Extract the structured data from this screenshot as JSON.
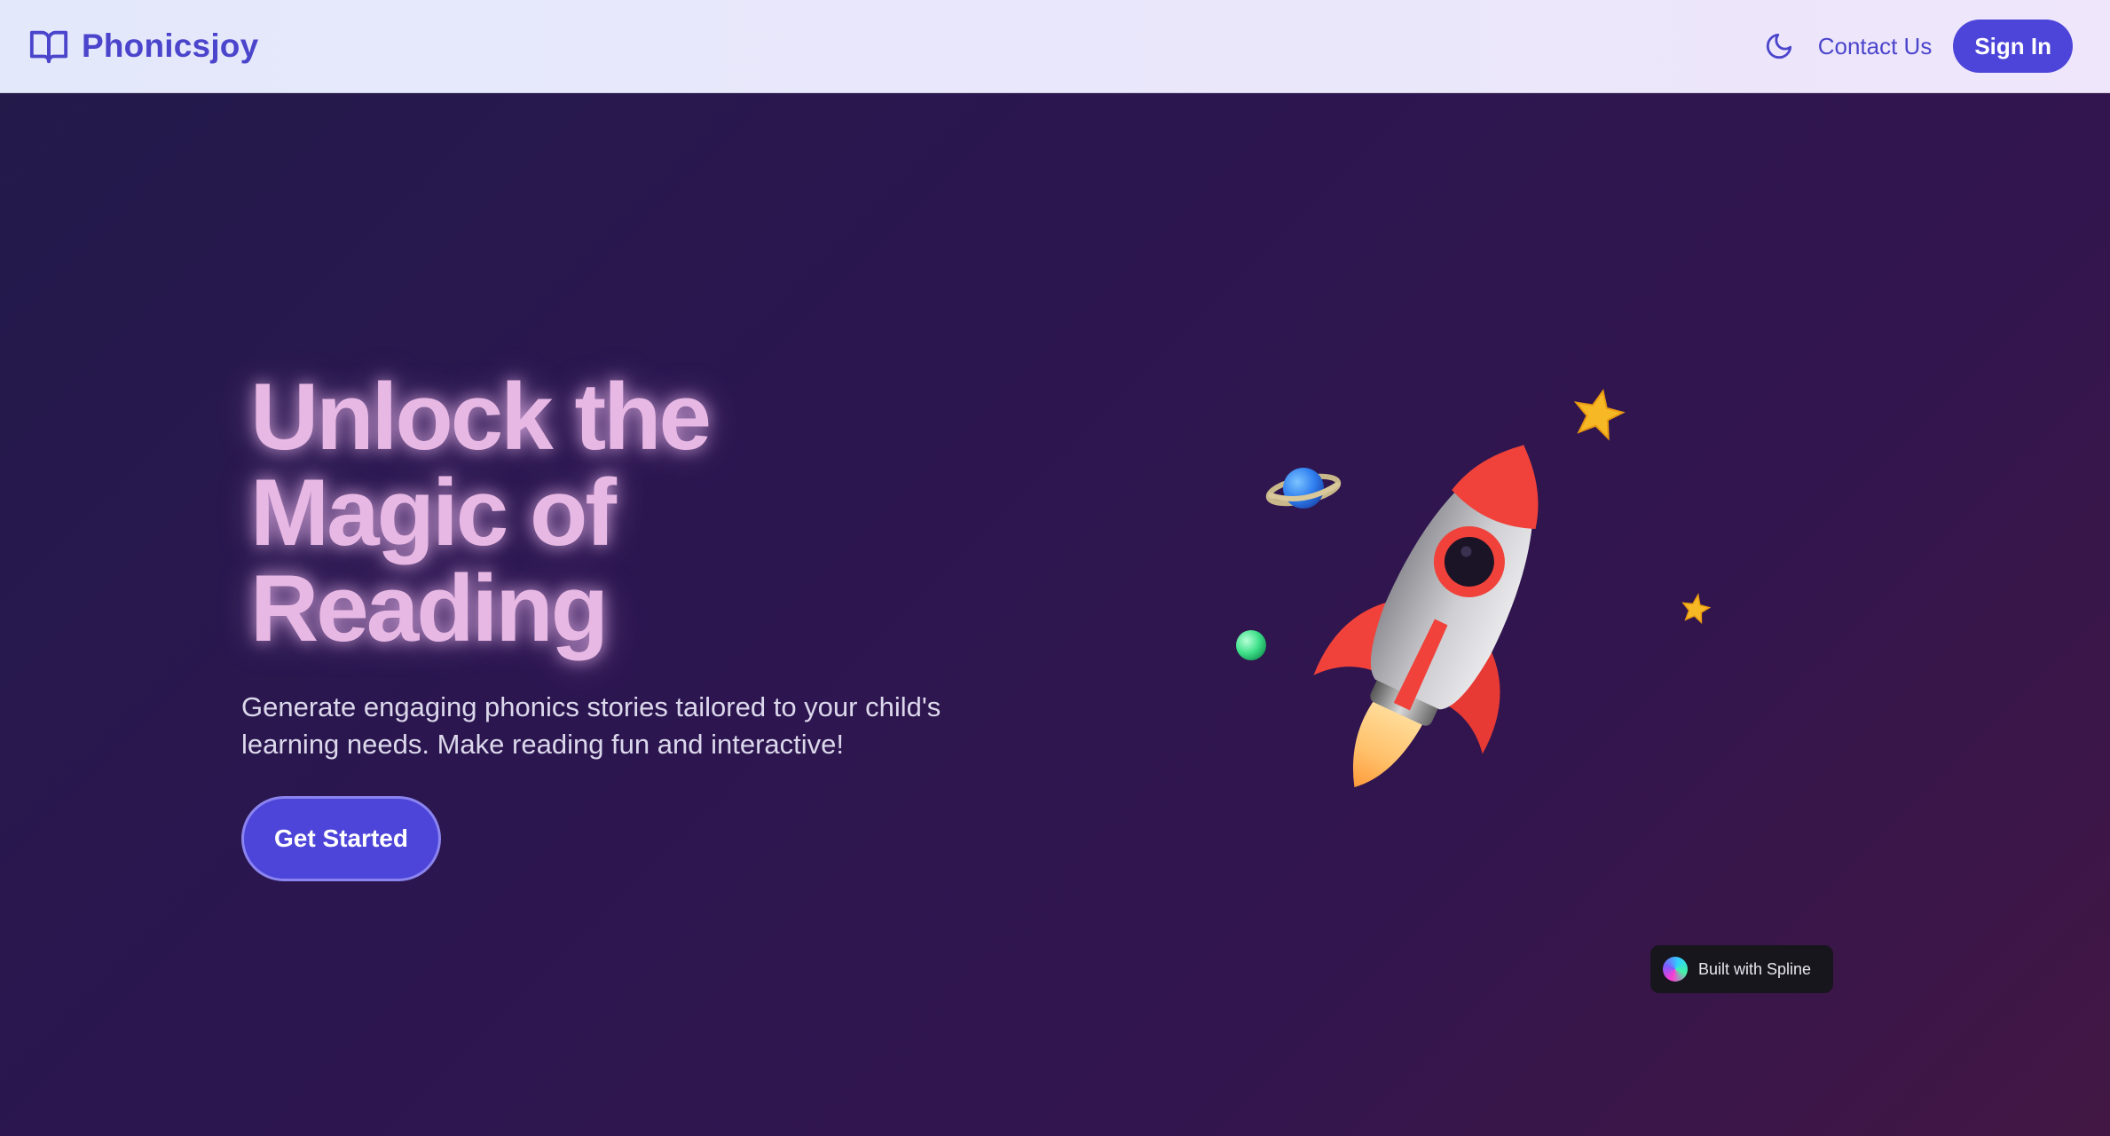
{
  "header": {
    "brand_name": "Phonicsjoy",
    "brand_icon": "open-book-icon",
    "theme_toggle_icon": "moon-icon",
    "contact_label": "Contact Us",
    "signin_label": "Sign In"
  },
  "hero": {
    "title_lines": [
      "Unlock the",
      "Magic of",
      "Reading"
    ],
    "subtitle": "Generate engaging phonics stories tailored to your child's learning needs. Make reading fun and interactive!",
    "cta_label": "Get Started"
  },
  "scene": {
    "objects": [
      "rocket-icon",
      "planet-icon",
      "star-icon",
      "small-star-icon",
      "green-orb-icon"
    ]
  },
  "spline_badge": {
    "label": "Built with Spline",
    "icon": "spline-logo-icon"
  },
  "colors": {
    "accent": "#4d45d9",
    "brand_text": "#4b45cc",
    "header_bg": "#e8e7fb",
    "hero_bg": "#2a1850",
    "title_glow": "#e7b8e4",
    "rocket_red": "#f0423a",
    "star_yellow": "#f7b825"
  }
}
